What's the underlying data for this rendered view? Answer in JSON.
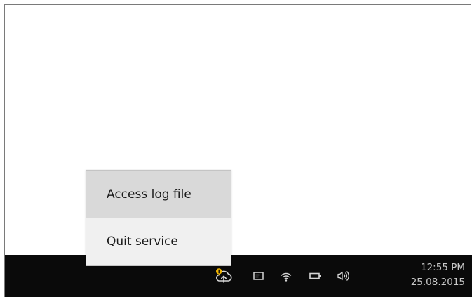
{
  "context_menu": {
    "items": [
      {
        "label": "Access log file",
        "highlighted": true
      },
      {
        "label": "Quit service",
        "highlighted": false
      }
    ]
  },
  "taskbar": {
    "tray_icons": [
      {
        "name": "cloud-upload-warning-icon",
        "badge_color": "#f0b400"
      },
      {
        "name": "keyboard-icon"
      },
      {
        "name": "wifi-icon"
      },
      {
        "name": "battery-icon"
      },
      {
        "name": "volume-icon"
      }
    ],
    "clock": {
      "time": "12:55 PM",
      "date": "25.08.2015"
    }
  },
  "colors": {
    "taskbar_bg": "#0a0a0a",
    "menu_bg": "#f0f0f0",
    "menu_highlight": "#d9d9d9",
    "icon_color": "#d6d6d6",
    "warning_badge": "#f0b400"
  }
}
